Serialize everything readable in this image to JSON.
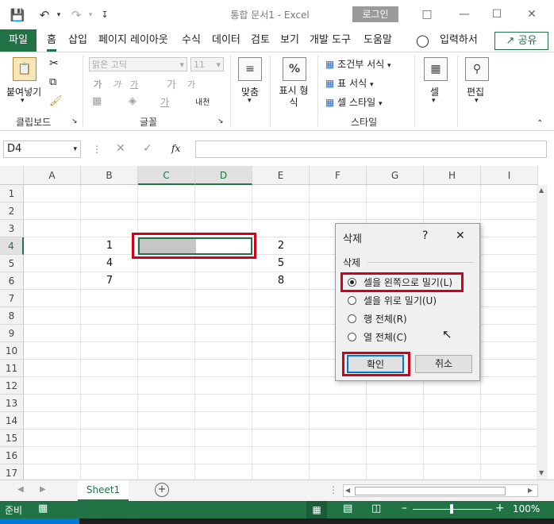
{
  "colors": {
    "accent": "#217346",
    "highlight": "#d0021b"
  },
  "titlebar": {
    "title": "통합 문서1  -  Excel",
    "login": "로그인",
    "save_icon": "save-icon",
    "undo_icon": "undo-icon",
    "redo_icon": "redo-icon"
  },
  "tabs": {
    "file": "파일",
    "items": [
      "홈",
      "삽입",
      "페이지 레이아웃",
      "수식",
      "데이터",
      "검토",
      "보기",
      "개발 도구",
      "도움말"
    ],
    "tell_me": "입력하서",
    "share": "공유"
  },
  "ribbon": {
    "paste": "붙여넣기",
    "clipboard": "클립보드",
    "font_name": "맑은 고딕",
    "font_size": "11",
    "font_group": "글꼴",
    "bold": "가",
    "italic": "가",
    "underline": "가",
    "grow": "가",
    "shrink": "가",
    "phonetic": "내천",
    "fontcolor": "가",
    "align": "맞춤",
    "number": "표시 형식",
    "cond_format": "조건부 서식",
    "table_format": "표 서식",
    "cell_style": "셀 스타일",
    "style_group": "스타일",
    "cells": "셀",
    "editing": "편집"
  },
  "formula_bar": {
    "name_box": "D4",
    "fx": "fx",
    "value": ""
  },
  "columns": [
    "A",
    "B",
    "C",
    "D",
    "E",
    "F",
    "G",
    "H",
    "I"
  ],
  "rows": [
    "1",
    "2",
    "3",
    "4",
    "5",
    "6",
    "7",
    "8",
    "9",
    "10",
    "11",
    "12",
    "13",
    "14",
    "15",
    "16",
    "17"
  ],
  "cells": [
    {
      "ref": "B4",
      "value": "1"
    },
    {
      "ref": "B5",
      "value": "4"
    },
    {
      "ref": "B6",
      "value": "7"
    },
    {
      "ref": "E4",
      "value": "2"
    },
    {
      "ref": "E5",
      "value": "5"
    },
    {
      "ref": "E6",
      "value": "8"
    }
  ],
  "sheet": {
    "tab": "Sheet1"
  },
  "status": {
    "ready": "준비",
    "zoom": "100%"
  },
  "dialog": {
    "title": "삭제",
    "help": "?",
    "close": "✕",
    "group": "삭제",
    "options": [
      "셀을 왼쪽으로 밀기(L)",
      "셀을 위로 밀기(U)",
      "행 전체(R)",
      "열 전체(C)"
    ],
    "selected": 0,
    "ok": "확인",
    "cancel": "취소"
  }
}
